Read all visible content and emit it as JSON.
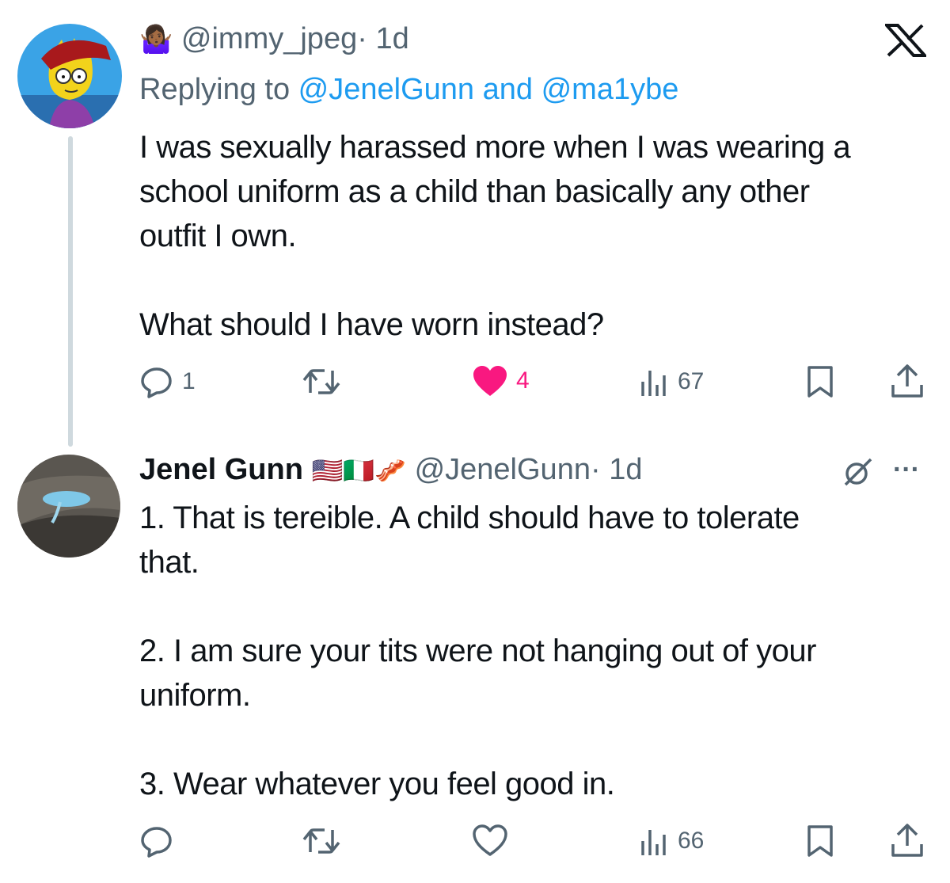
{
  "tweet1": {
    "emoji": "🤷🏾‍♀️",
    "handle": "@immy_jpeg",
    "sep": "·",
    "time": "1d",
    "replying_prefix": "Replying to ",
    "reply_to_1": "@JenelGunn",
    "reply_and": " and ",
    "reply_to_2": "@ma1ybe",
    "lines": [
      "I was sexually harassed more when I was wearing a",
      "school uniform as a child than basically any other",
      "outfit I own.",
      "What should I have worn instead?"
    ],
    "reply_count": "1",
    "like_count": "4",
    "view_count": "67"
  },
  "tweet2": {
    "name": "Jenel Gunn",
    "flags": "🇺🇸🇮🇹🥓",
    "handle": "@JenelGunn",
    "sep": "·",
    "time": "1d",
    "more": "···",
    "lines": [
      "1. That is tereible. A child should have to tolerate",
      "that.",
      "2. I am sure your tits were not hanging out of your",
      "uniform.",
      "3. Wear whatever you feel good in."
    ],
    "view_count": "66"
  },
  "app_logo": "X",
  "colors": {
    "link": "#1d9bf0",
    "like": "#f91880",
    "muted": "#536471",
    "text": "#0f1419"
  },
  "icons": [
    "reply-icon",
    "retweet-icon",
    "heart-icon",
    "views-icon",
    "bookmark-icon",
    "share-icon",
    "x-logo-icon",
    "grok-icon"
  ]
}
